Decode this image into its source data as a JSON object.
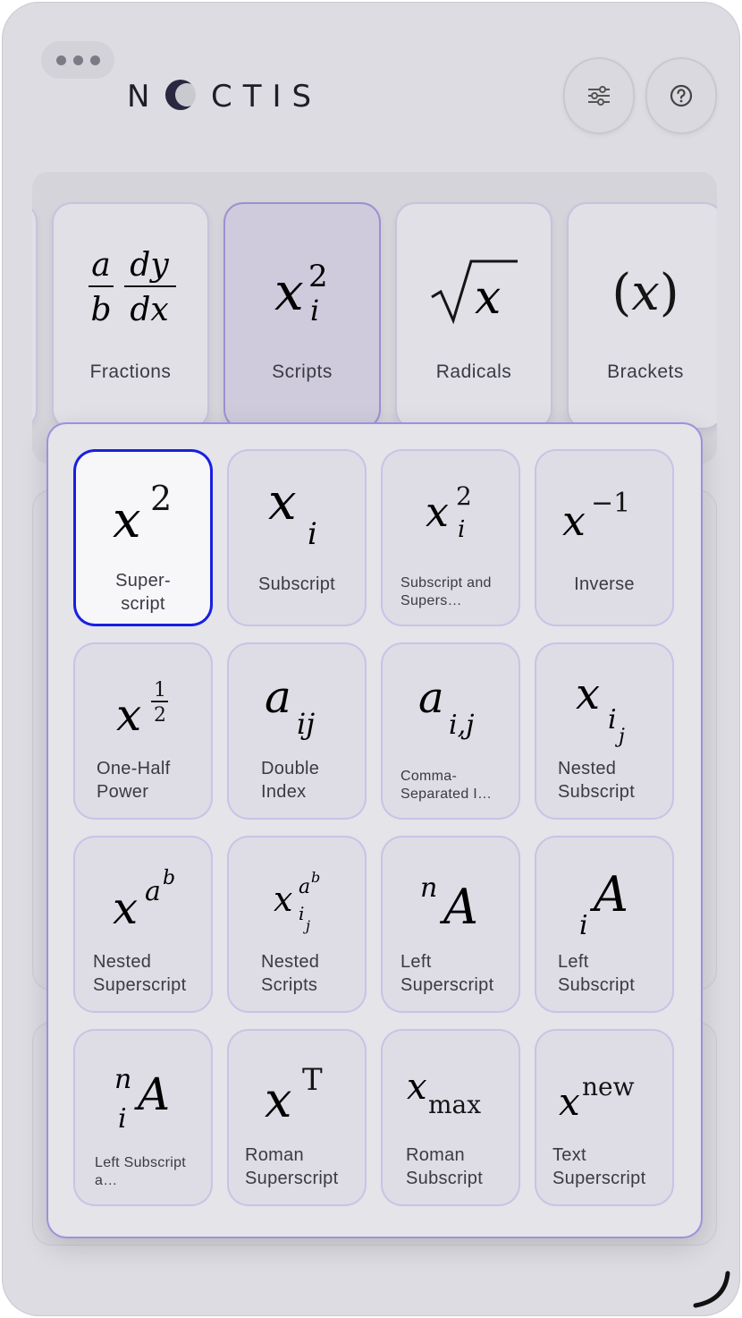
{
  "app": {
    "logo_text": "N  CTIS",
    "brand": "NOCTIS"
  },
  "header": {
    "menu_button": "more-options",
    "settings_icon": "sliders-icon",
    "help_icon": "help-circle-icon"
  },
  "categories": [
    {
      "label": "Fractions"
    },
    {
      "label": "Scripts"
    },
    {
      "label": "Radicals"
    },
    {
      "label": "Brackets"
    }
  ],
  "scripts": {
    "items": [
      {
        "label": "Super-\nscript",
        "label_display": "Super-script"
      },
      {
        "label": "Subscript"
      },
      {
        "label": "Subscript and Supers…"
      },
      {
        "label": "Inverse"
      },
      {
        "label": "One-Half Power"
      },
      {
        "label": "Double Index"
      },
      {
        "label": "Comma-Separated I…"
      },
      {
        "label": "Nested Subscript"
      },
      {
        "label": "Nested Superscript"
      },
      {
        "label": "Nested Scripts"
      },
      {
        "label": "Left Superscript"
      },
      {
        "label": "Left Subscript"
      },
      {
        "label": "Left Subscript a…"
      },
      {
        "label": "Roman Superscript"
      },
      {
        "label": "Roman Subscript"
      },
      {
        "label": "Text Superscript"
      }
    ],
    "selected_index": 0
  },
  "colors": {
    "accent": "#1a1fe0",
    "panel_border": "#9f90dc",
    "active_category": "#cfcbdc"
  }
}
